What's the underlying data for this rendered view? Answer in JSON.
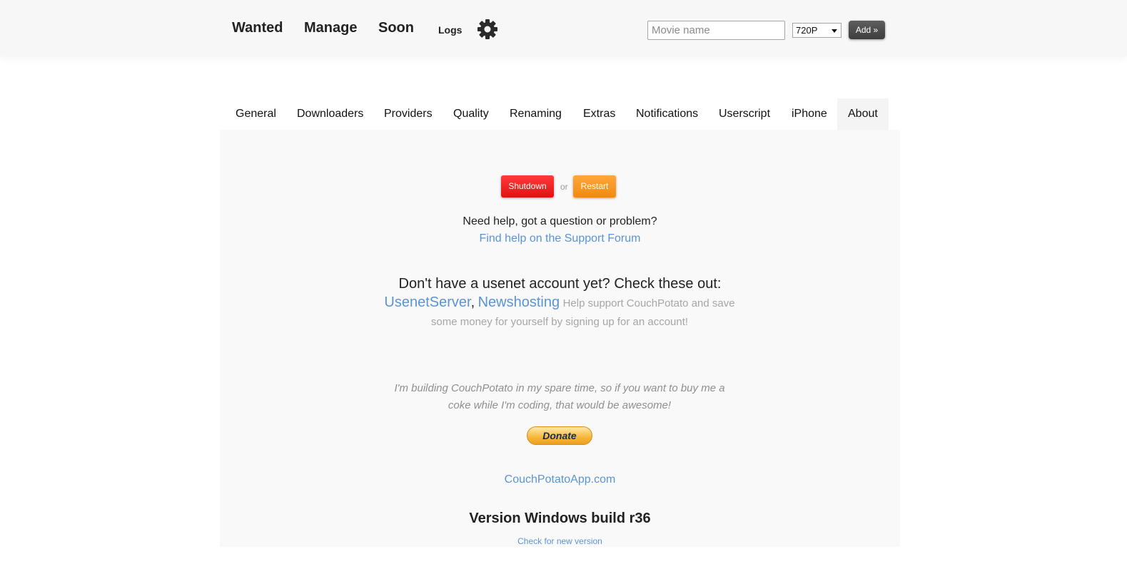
{
  "nav": {
    "wanted": "Wanted",
    "manage": "Manage",
    "soon": "Soon",
    "logs": "Logs",
    "settings_icon": "gear-icon"
  },
  "add_movie": {
    "placeholder": "Movie name",
    "quality": "720P",
    "add_label": "Add »"
  },
  "tabs": [
    {
      "label": "General"
    },
    {
      "label": "Downloaders"
    },
    {
      "label": "Providers"
    },
    {
      "label": "Quality"
    },
    {
      "label": "Renaming"
    },
    {
      "label": "Extras"
    },
    {
      "label": "Notifications"
    },
    {
      "label": "Userscript"
    },
    {
      "label": "iPhone"
    },
    {
      "label": "About",
      "active": true
    }
  ],
  "about": {
    "shutdown_label": "Shutdown",
    "or_text": "or",
    "restart_label": "Restart",
    "help_question": "Need help, got a question or problem?",
    "support_link": "Find help on the Support Forum",
    "usenet_heading": "Don't have a usenet account yet? Check these out:",
    "usenet_server": "UsenetServer",
    "newshosting": "Newshosting",
    "usenet_text": "Help support CouchPotato and save some money for yourself by signing up for an account!",
    "donate_text": "I'm building CouchPotato in my spare time, so if you want to buy me a coke while I'm coding, that would be awesome!",
    "donate_label": "Donate",
    "website": "CouchPotatoApp.com",
    "version": "Version Windows build r36",
    "check_version": "Check for new version"
  },
  "colors": {
    "link": "#5b94d6",
    "shutdown": "#f01a1a",
    "restart": "#f59a20",
    "panel_bg": "#f9f9f9"
  }
}
